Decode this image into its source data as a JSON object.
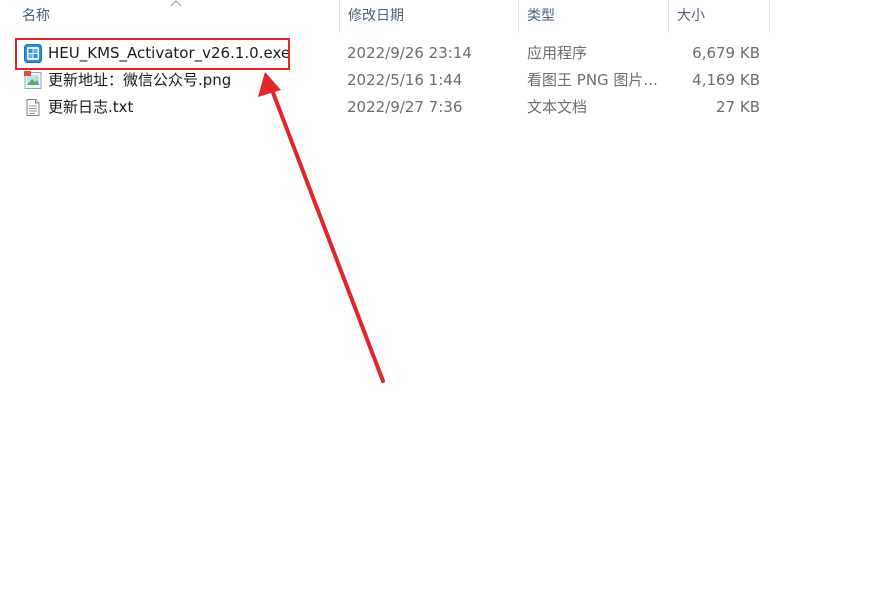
{
  "columns": {
    "name": "名称",
    "date": "修改日期",
    "type": "类型",
    "size": "大小"
  },
  "files": [
    {
      "name": "HEU_KMS_Activator_v26.1.0.exe",
      "date": "2022/9/26 23:14",
      "type": "应用程序",
      "size": "6,679 KB",
      "icon": "exe-app-icon"
    },
    {
      "name": "更新地址：微信公众号.png",
      "date": "2022/5/16 1:44",
      "type": "看图王 PNG 图片...",
      "size": "4,169 KB",
      "icon": "png-image-icon"
    },
    {
      "name": "更新日志.txt",
      "date": "2022/9/27 7:36",
      "type": "文本文档",
      "size": "27 KB",
      "icon": "txt-document-icon"
    }
  ],
  "annotation": {
    "color": "#e0262b"
  }
}
